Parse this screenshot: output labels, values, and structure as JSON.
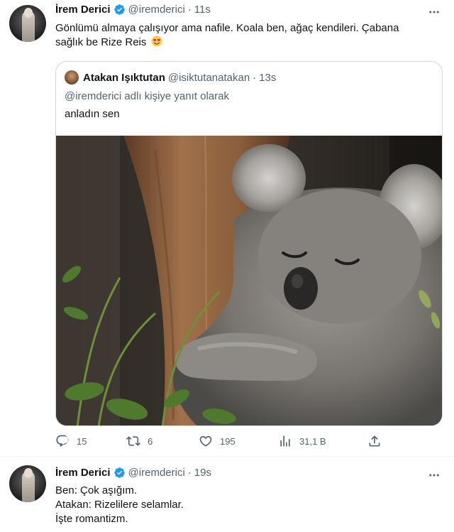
{
  "tweets": [
    {
      "name": "İrem Derici",
      "handle": "@iremderici",
      "time": "11s",
      "lines": [
        "Gönlümü almaya çalışıyor ama nafile. Koala ben, ağaç kendileri. Çabana",
        "sağlık be Rize Reis"
      ],
      "emoji": "smiling-face-with-heart-eyes",
      "quote": {
        "name": "Atakan Işıktutan",
        "handle": "@isiktutanatakan",
        "time": "13s",
        "reply_context": "@iremderici adlı kişiye yanıt olarak",
        "text": "anladın sen",
        "image": "koala-hugging-tree-photo"
      },
      "stats": {
        "replies": "15",
        "retweets": "6",
        "likes": "195",
        "views": "31,1 B"
      }
    },
    {
      "name": "İrem Derici",
      "handle": "@iremderici",
      "time": "19s",
      "lines": [
        "Ben: Çok aşığım.",
        "Atakan: Rizelilere selamlar.",
        "İşte romantizm."
      ]
    }
  ],
  "colors": {
    "text_primary": "#0f1419",
    "text_secondary": "#536471",
    "verified_blue": "#1d9bf0",
    "border": "#cfd9de"
  }
}
